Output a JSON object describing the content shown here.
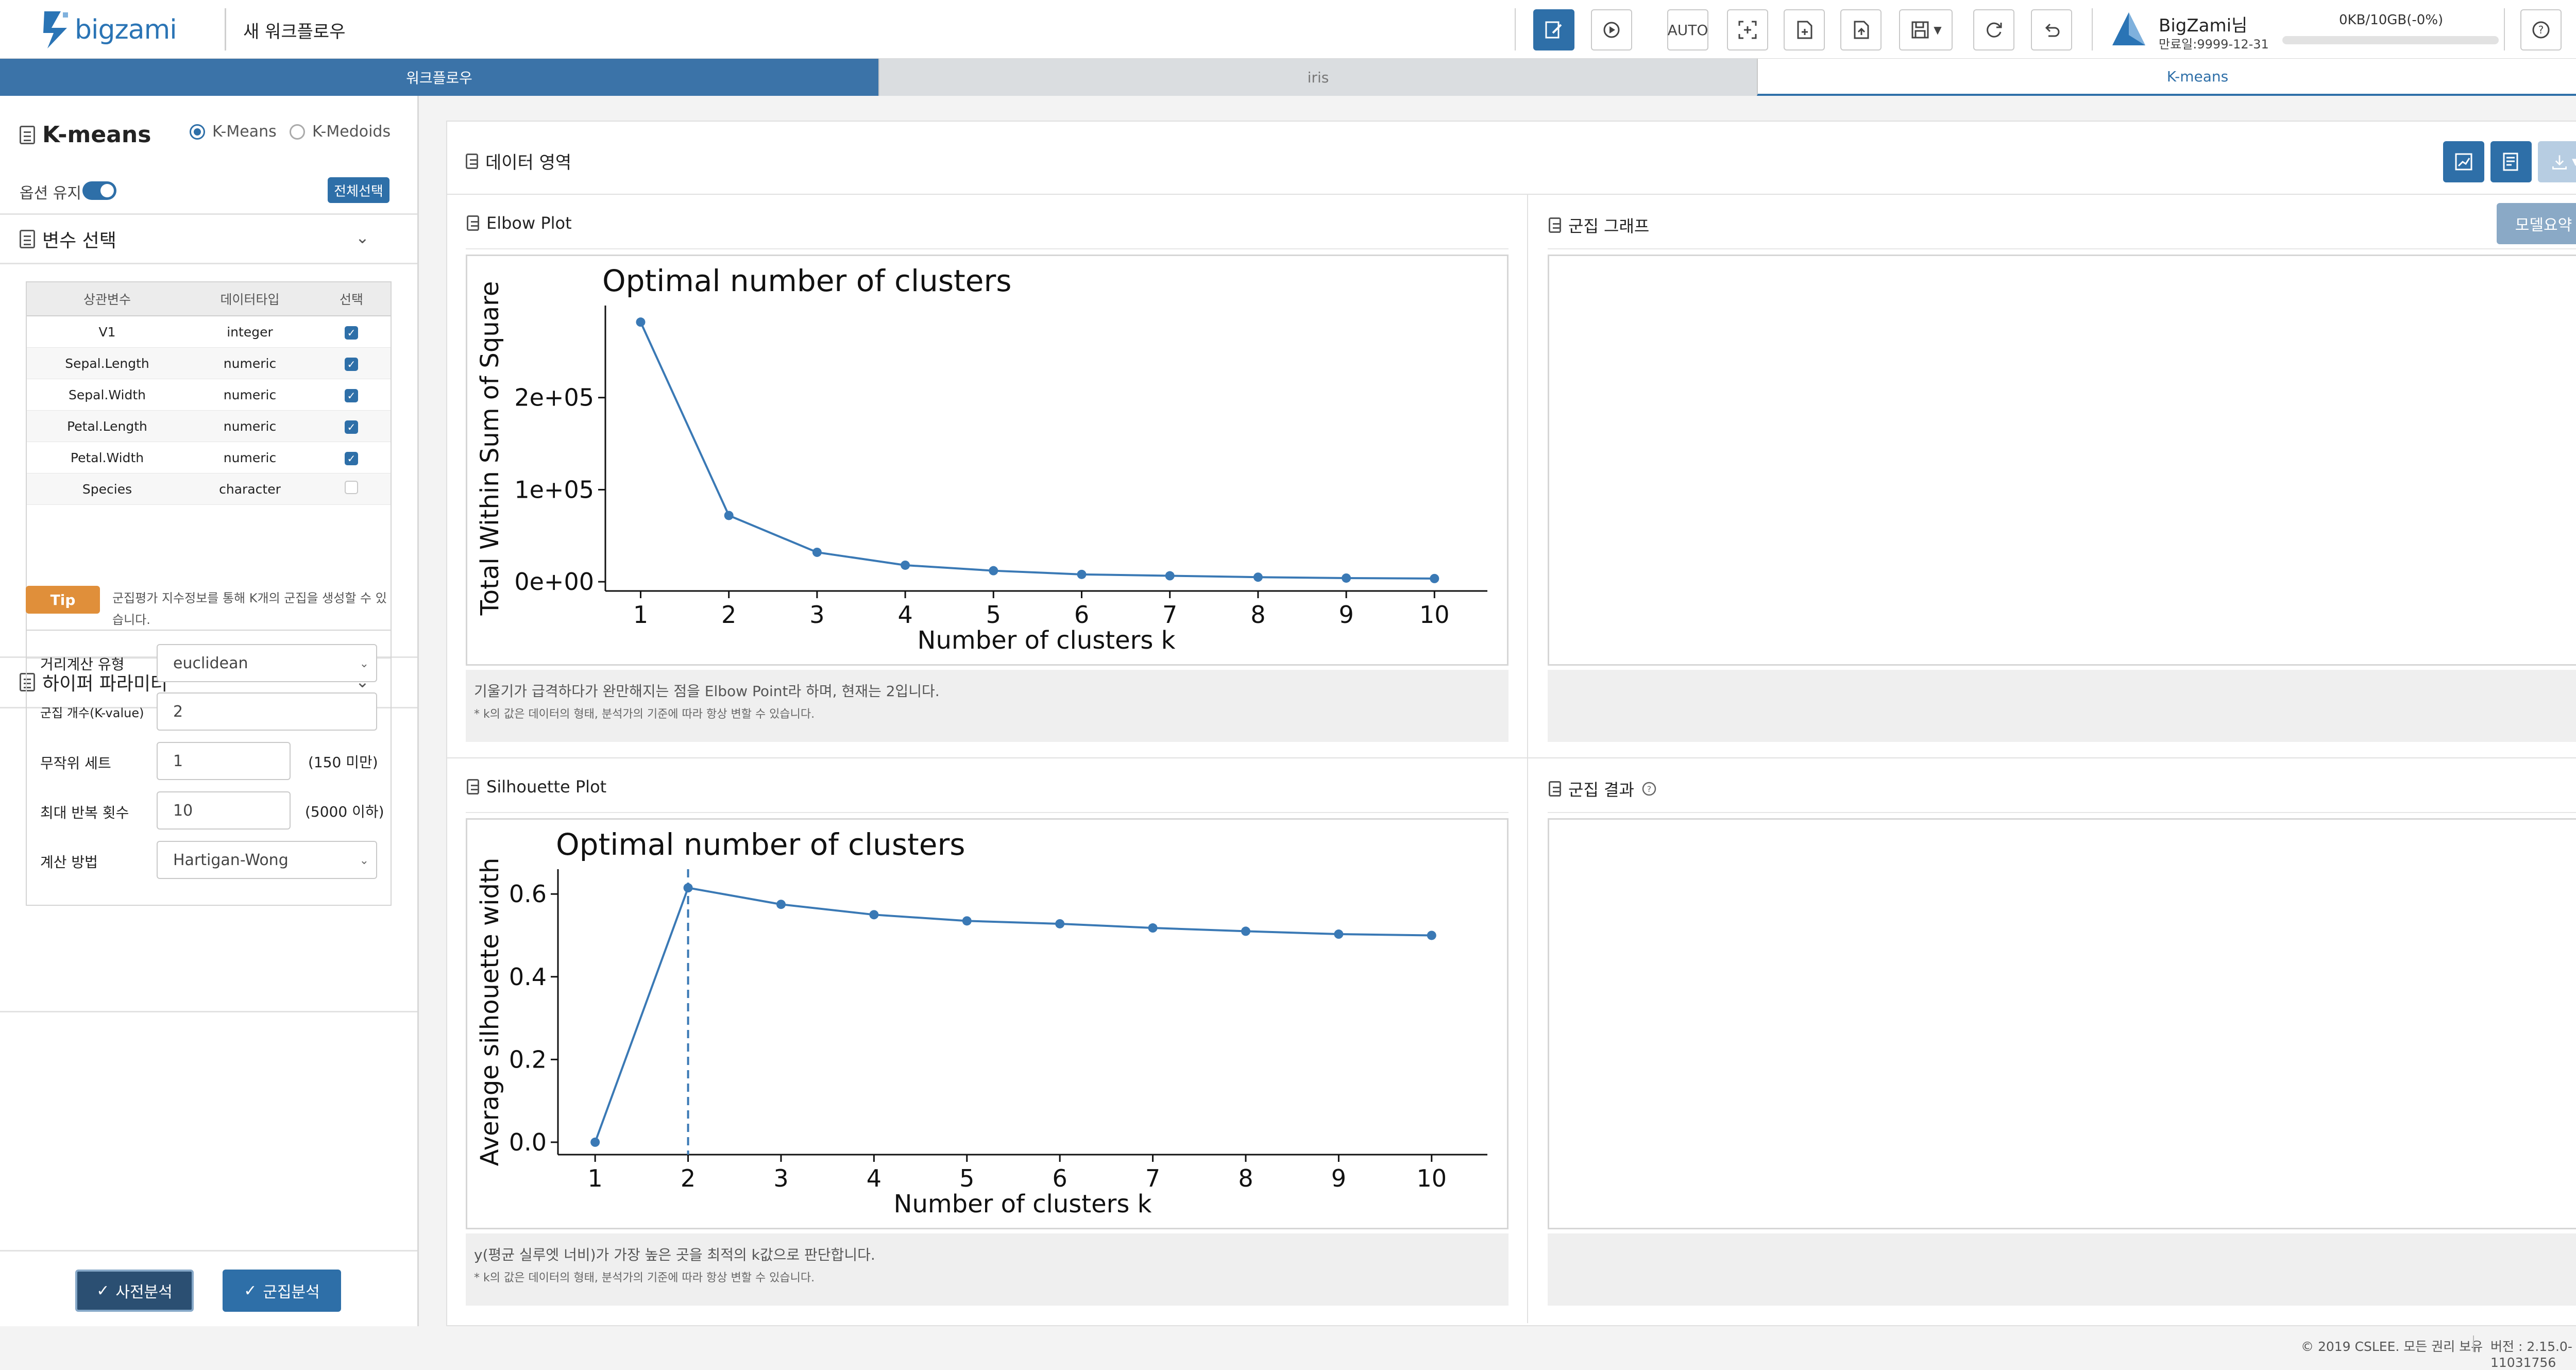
{
  "header": {
    "logo_text": "bigzami",
    "workflow_title": "새 워크플로우",
    "auto_label": "AUTO",
    "user_name": "BigZami님",
    "user_expiry": "만료일:9999-12-31",
    "storage_text": "0KB/10GB(-0%)",
    "storage_used_fraction": 0
  },
  "tabs": [
    {
      "label": "워크플로우"
    },
    {
      "label": "iris"
    },
    {
      "label": "K-means"
    }
  ],
  "left": {
    "title": "K-means",
    "method_options": [
      {
        "label": "K-Means",
        "checked": true
      },
      {
        "label": "K-Medoids",
        "checked": false
      }
    ],
    "keep_option_label": "옵션 유지",
    "select_all_label": "전체선택",
    "variable_section_title": "변수 선택",
    "variable_table": {
      "headers": [
        "상관변수",
        "데이터타입",
        "선택"
      ],
      "rows": [
        {
          "name": "V1",
          "type": "integer",
          "selected": true
        },
        {
          "name": "Sepal.Length",
          "type": "numeric",
          "selected": true
        },
        {
          "name": "Sepal.Width",
          "type": "numeric",
          "selected": true
        },
        {
          "name": "Petal.Length",
          "type": "numeric",
          "selected": true
        },
        {
          "name": "Petal.Width",
          "type": "numeric",
          "selected": true
        },
        {
          "name": "Species",
          "type": "character",
          "selected": false
        }
      ]
    },
    "tip_label": "Tip",
    "tip_text": "군집평가 지수정보를 통해 K개의 군집을 생성할 수 있습니다.",
    "hyper_section_title": "하이퍼 파라미터",
    "params": {
      "distance_label": "거리계산 유형",
      "distance_value": "euclidean",
      "k_label": "군집 개수(K-value)",
      "k_value": "2",
      "seed_label": "무작위 세트",
      "seed_value": "1",
      "seed_note": "(150 미만)",
      "iter_label": "최대 반복 횟수",
      "iter_value": "10",
      "iter_note": "(5000 이하)",
      "algo_label": "계산 방법",
      "algo_value": "Hartigan-Wong"
    },
    "pre_analysis_label": "사전분석",
    "cluster_analysis_label": "군집분석"
  },
  "main": {
    "title": "데이터 영역",
    "elbow_title": "Elbow Plot",
    "cluster_graph_title": "군집 그래프",
    "model_summary_label": "모델요약",
    "silhouette_title": "Silhouette Plot",
    "cluster_result_title": "군집 결과",
    "elbow_note": "기울기가 급격하다가 완만해지는 점을 Elbow Point라 하며, 현재는 2입니다.",
    "elbow_subnote": "* k의 값은 데이터의 형태, 분석가의 기준에 따라 항상 변할 수 있습니다.",
    "sil_note": "y(평균 실루엣 너비)가 가장 높은 곳을 최적의 k값으로 판단합니다.",
    "sil_subnote": "* k의 값은 데이터의 형태, 분석가의 기준에 따라 항상 변할 수 있습니다."
  },
  "footer": {
    "copyright": "© 2019 CSLEE. 모든 권리 보유",
    "version": "버전 : 2.15.0-11031756"
  },
  "colors": {
    "accent": "#2e6fa8",
    "tab_active": "#3b73a8",
    "tip": "#e08f3a",
    "plot_line": "#3a79b5"
  },
  "chart_data": [
    {
      "type": "line",
      "title": "Optimal number of clusters",
      "xlabel": "Number of clusters k",
      "ylabel": "Total Within Sum of Square",
      "x": [
        1,
        2,
        3,
        4,
        5,
        6,
        7,
        8,
        9,
        10
      ],
      "series": [
        {
          "values": [
            282000,
            72000,
            32000,
            18000,
            12000,
            8000,
            6500,
            5000,
            4000,
            3500
          ]
        }
      ],
      "ylim": [
        -10000,
        300000
      ],
      "yticks": [
        0,
        100000,
        200000
      ],
      "ytick_labels": [
        "0e+00",
        "1e+05",
        "2e+05"
      ],
      "grid": false
    },
    {
      "type": "line",
      "title": "Optimal number of clusters",
      "xlabel": "Number of clusters k",
      "ylabel": "Average silhouette width",
      "x": [
        1,
        2,
        3,
        4,
        5,
        6,
        7,
        8,
        9,
        10
      ],
      "series": [
        {
          "values": [
            0.0,
            0.615,
            0.575,
            0.55,
            0.535,
            0.528,
            0.518,
            0.51,
            0.503,
            0.5
          ]
        }
      ],
      "ylim": [
        -0.03,
        0.66
      ],
      "yticks": [
        0.0,
        0.2,
        0.4,
        0.6
      ],
      "ytick_labels": [
        "0.0",
        "0.2",
        "0.4",
        "0.6"
      ],
      "optimal_k": 2,
      "grid": false
    }
  ]
}
